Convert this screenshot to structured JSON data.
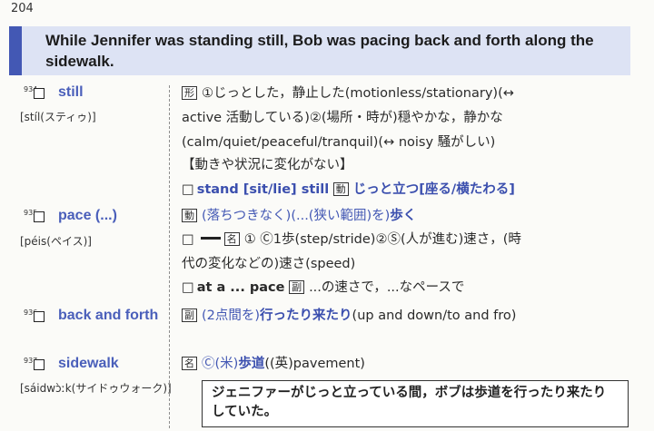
{
  "page_number": "204",
  "banner": {
    "sentence": "While Jennifer was standing still, Bob was pacing back and forth along the sidewalk."
  },
  "entries": [
    {
      "number": "934",
      "word": "still",
      "pronunciation": "[stíl(スティゥ)]",
      "lines": [
        {
          "tag": "形",
          "text": "①じっとした，静止した(motionless/stationary)(↔"
        },
        {
          "text": "active 活動している)②(場所・時が)穏やかな，静かな"
        },
        {
          "text": "(calm/quiet/peaceful/tranquil)(↔ noisy 騒がしい)"
        },
        {
          "text": "【動きや状況に変化がない】"
        },
        {
          "square": "□",
          "phrase": "stand [sit/lie] still",
          "tag": "動",
          "meaning": "じっと立つ[座る/横たわる]"
        }
      ]
    },
    {
      "number": "935",
      "word": "pace (...)",
      "pronunciation": "[péis(ペイス)]",
      "lines": [
        {
          "tag": "動",
          "note": "(落ちつきなく)(...(狭い範囲)を)",
          "meaning": "歩く"
        },
        {
          "square": "□",
          "tag": "名",
          "text": "① Ⓒ1歩(step/stride)②Ⓢ(人が進む)速さ，(時"
        },
        {
          "text": "代の変化などの)速さ(speed)"
        },
        {
          "square": "□",
          "phrase": "at a ... pace",
          "tag": "副",
          "meaning": "...の速さで，...なペースで"
        }
      ]
    },
    {
      "number": "936",
      "word": "back and forth",
      "lines": [
        {
          "tag": "副",
          "note": "(2点間を)",
          "meaning": "行ったり来たり",
          "text": "(up and down/to and fro)"
        }
      ]
    },
    {
      "number": "937",
      "word": "sidewalk",
      "pronunciation": "[sáidwɔ̀ːk(サイドゥウォーク)]",
      "lines": [
        {
          "tag": "名",
          "note": "Ⓒ(米)",
          "meaning": "歩道",
          "text": "((英)pavement)"
        }
      ]
    }
  ],
  "translation": {
    "line1": "ジェニファーがじっと立っている間，ボブは歩道を行ったり来たりしていた。"
  }
}
